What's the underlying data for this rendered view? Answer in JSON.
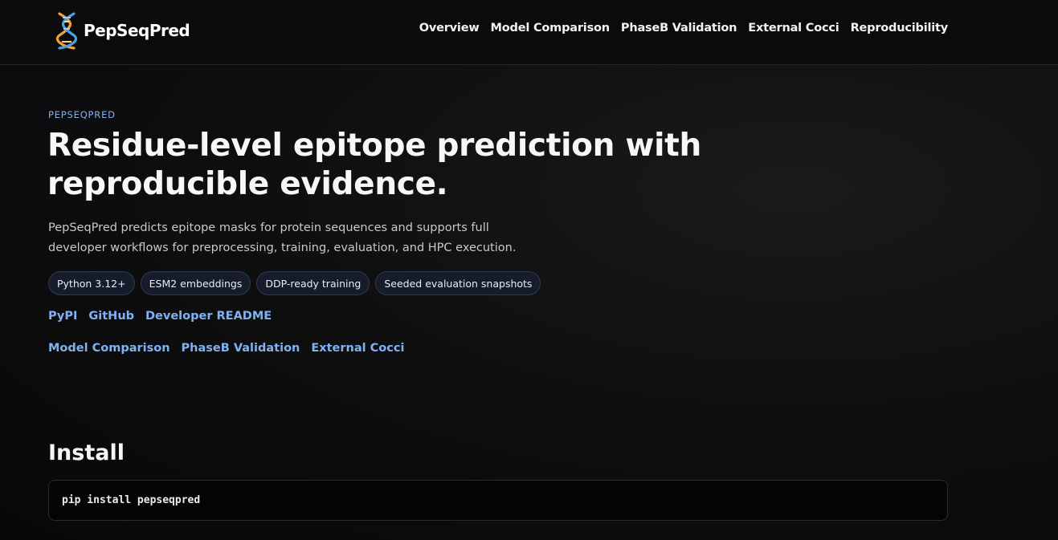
{
  "header": {
    "brand_name": "PepSeqPred",
    "nav": [
      {
        "label": "Overview"
      },
      {
        "label": "Model Comparison"
      },
      {
        "label": "PhaseB Validation"
      },
      {
        "label": "External Cocci"
      },
      {
        "label": "Reproducibility"
      }
    ]
  },
  "hero": {
    "eyebrow": "PEPSEQPRED",
    "title": "Residue-level epitope prediction with reproducible evidence.",
    "description": "PepSeqPred predicts epitope masks for protein sequences and supports full developer workflows for preprocessing, training, evaluation, and HPC execution.",
    "badges": [
      {
        "label": "Python 3.12+"
      },
      {
        "label": "ESM2 embeddings"
      },
      {
        "label": "DDP-ready training"
      },
      {
        "label": "Seeded evaluation snapshots"
      }
    ],
    "links_primary": [
      {
        "label": "PyPI"
      },
      {
        "label": "GitHub"
      },
      {
        "label": "Developer README"
      }
    ],
    "links_secondary": [
      {
        "label": "Model Comparison"
      },
      {
        "label": "PhaseB Validation"
      },
      {
        "label": "External Cocci"
      }
    ]
  },
  "install": {
    "title": "Install",
    "command": "pip install pepseqpred"
  },
  "colors": {
    "background": "#0a0a0b",
    "link": "#7fb2f5",
    "badge_bg": "#161c2b",
    "badge_border": "#2f3a52"
  },
  "icons": {
    "logo": "dna-helix-icon"
  }
}
